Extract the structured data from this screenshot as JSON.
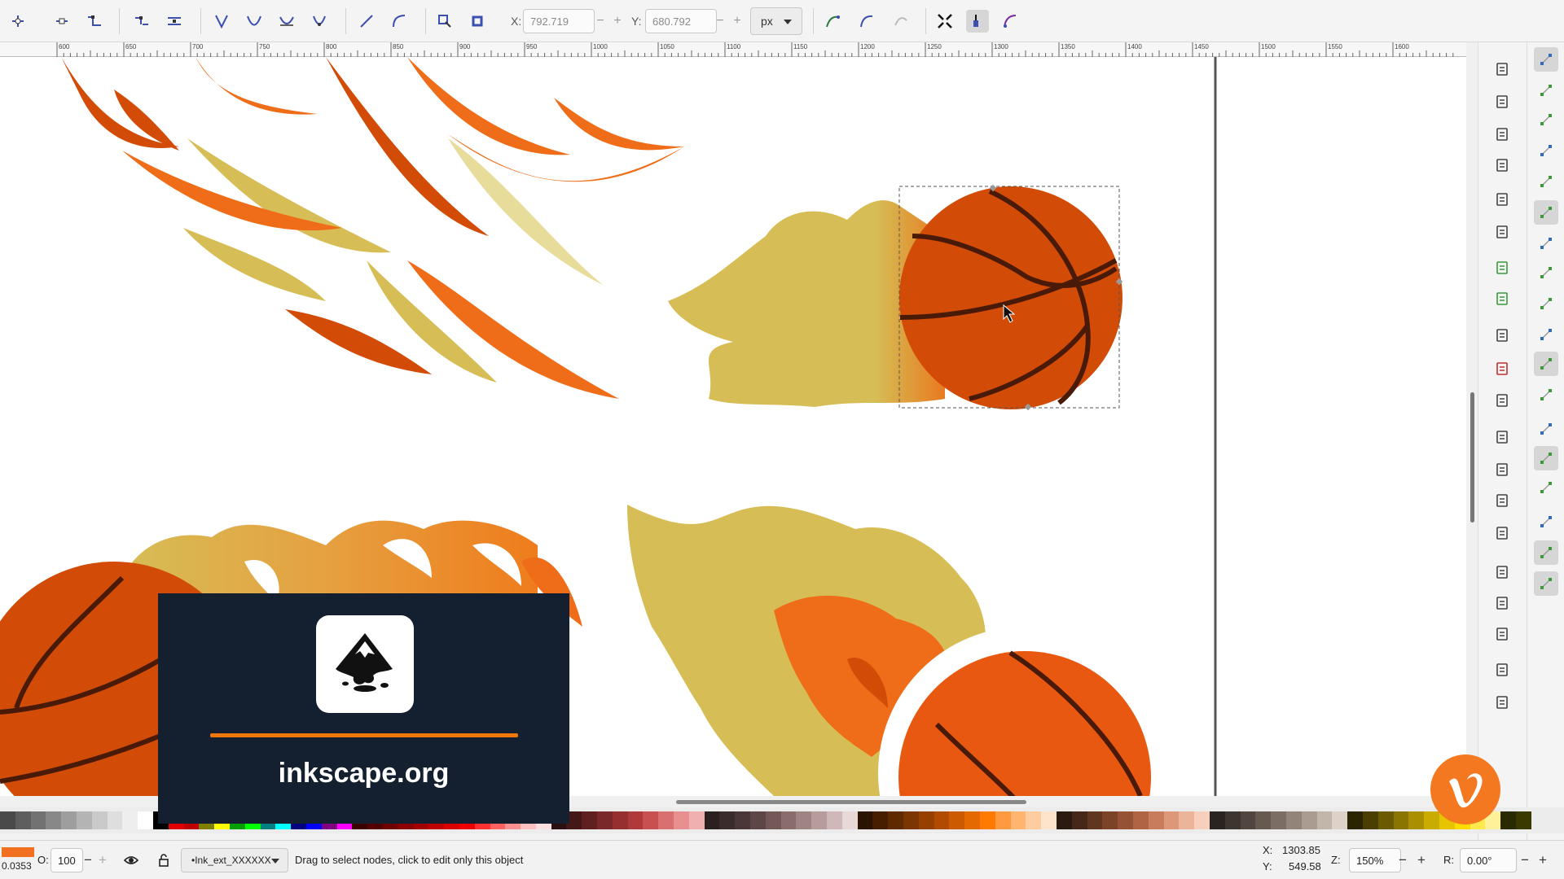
{
  "toolbar": {
    "x_label": "X:",
    "x_value": "792.719",
    "y_label": "Y:",
    "y_value": "680.792",
    "unit": "px",
    "minus": "−",
    "plus": "+"
  },
  "ruler": {
    "ticks": [
      "600",
      "650",
      "700",
      "750",
      "800",
      "850",
      "900",
      "950",
      "1000",
      "1050",
      "1100",
      "1150",
      "1200",
      "1250",
      "1300",
      "1350",
      "1400",
      "1450",
      "1500",
      "1550",
      "1600"
    ]
  },
  "promo": {
    "url": "inkscape.org"
  },
  "statusbar": {
    "fill_value": "0.0353",
    "opacity_label": "O:",
    "opacity_value": "100",
    "layer": "•Ink_ext_XXXXXX",
    "message": "Drag to select nodes, click to edit only this object",
    "cursor_x_label": "X:",
    "cursor_x": "1303.85",
    "cursor_y_label": "Y:",
    "cursor_y": "549.58",
    "zoom_label": "Z:",
    "zoom_value": "150%",
    "rotate_label": "R:",
    "rotate_value": "0.00°",
    "minus": "−",
    "plus": "+"
  },
  "palette": {
    "colors": [
      "#4a4a4a",
      "#5e5e5e",
      "#727272",
      "#888888",
      "#9e9e9e",
      "#b4b4b4",
      "#cacaca",
      "#dedede",
      "#eeeeee",
      "#ffffff",
      "#000000",
      "#e00000",
      "#c00000",
      "#808000",
      "#ffff00",
      "#00a000",
      "#00ff00",
      "#008080",
      "#00ffff",
      "#000080",
      "#0000ff",
      "#800080",
      "#ff00ff",
      "#3a0000",
      "#550000",
      "#700000",
      "#8b0000",
      "#a50000",
      "#c00000",
      "#db0000",
      "#f00000",
      "#ff3030",
      "#ff6060",
      "#ff9090",
      "#ffc0c0",
      "#ffe0e0",
      "#2a1010",
      "#451818",
      "#602020",
      "#7b2828",
      "#963030",
      "#b03a3a",
      "#c85050",
      "#d87070",
      "#e89090",
      "#f0b0b0",
      "#2a2020",
      "#3a2c2c",
      "#4a3838",
      "#5e4646",
      "#745858",
      "#8a6c6c",
      "#a08484",
      "#b89c9c",
      "#d0b8b8",
      "#e8d8d8",
      "#2a1400",
      "#451f00",
      "#602a00",
      "#7b3500",
      "#964000",
      "#b04b00",
      "#cc5a00",
      "#e46a00",
      "#ff7b00",
      "#ff9a40",
      "#ffb470",
      "#ffcca0",
      "#ffe4cc",
      "#2a1a10",
      "#452818",
      "#603620",
      "#7b4428",
      "#965234",
      "#b06444",
      "#c87c5c",
      "#dc9878",
      "#ecb498",
      "#f6d0bc",
      "#2a2420",
      "#3d3530",
      "#50463f",
      "#655950",
      "#7b6d63",
      "#928478",
      "#aa9c90",
      "#c2b6aa",
      "#dcd2c8",
      "#2a2400",
      "#4a3f00",
      "#6a5a00",
      "#8a7500",
      "#aa9000",
      "#caab00",
      "#e6c400",
      "#ffdc00",
      "#ffe94d",
      "#fff199",
      "#2a2a00",
      "#3a3a00"
    ]
  },
  "icons": {
    "toolbar": [
      "insert-node-icon",
      "delete-node-icon",
      "join-nodes-icon",
      "break-path-icon",
      "join-segment-icon",
      "delete-segment-icon",
      "node-cusp-icon",
      "node-smooth-icon",
      "node-symmetric-icon",
      "node-auto-icon",
      "segment-line-icon",
      "segment-curve-icon",
      "object-to-path-icon",
      "stroke-to-path-icon",
      "show-outline-icon",
      "show-handles-icon",
      "show-clipmask-icon",
      "transform-handles-icon",
      "edit-mask-icon",
      "edit-clip-icon"
    ],
    "commands": [
      "new-document-icon",
      "open-document-icon",
      "save-document-icon",
      "print-icon",
      "import-icon",
      "export-icon",
      "undo-icon",
      "redo-icon",
      "copy-icon",
      "cut-icon",
      "paste-icon",
      "zoom-selection-icon",
      "zoom-drawing-icon",
      "zoom-page-icon",
      "zoom-page-width-icon",
      "duplicate-icon",
      "clone-icon",
      "unlink-clone-icon",
      "group-icon",
      "ungroup-icon"
    ],
    "snap": [
      "snap-enable-icon",
      "snap-bbox-icon",
      "snap-bbox-edge-icon",
      "snap-bbox-corner-icon",
      "snap-bbox-midpoint-icon",
      "snap-nodes-icon",
      "snap-path-icon",
      "snap-intersection-icon",
      "snap-cusp-icon",
      "snap-smooth-icon",
      "snap-midpoint-icon",
      "snap-others-icon",
      "snap-center-icon",
      "snap-rotation-icon",
      "snap-text-baseline-icon",
      "snap-page-icon",
      "snap-grid-icon",
      "snap-guide-icon"
    ]
  }
}
